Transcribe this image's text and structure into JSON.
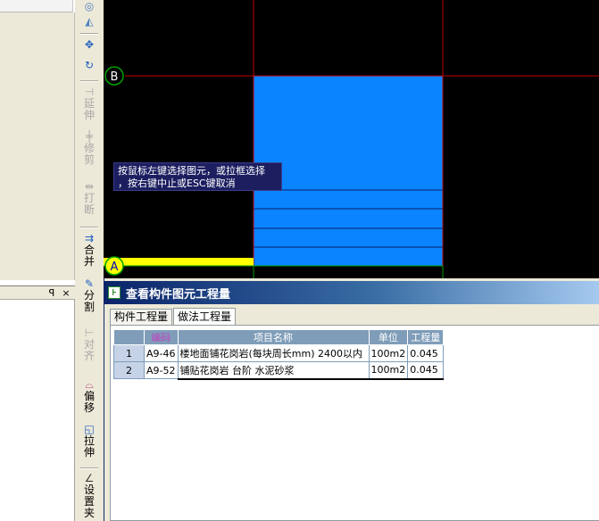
{
  "left_panel": {
    "lower_header": {
      "pin": "ꟼ",
      "close": "×"
    }
  },
  "toolbar": {
    "items": [
      {
        "name": "arc-tool",
        "icon": "◎",
        "label": "",
        "state": "enabled"
      },
      {
        "name": "mirror-tool",
        "icon": "◭",
        "label": "",
        "state": "enabled"
      },
      {
        "name": "move-tool",
        "icon": "✥",
        "label": "",
        "state": "enabled"
      },
      {
        "name": "rotate-tool",
        "icon": "↻",
        "label": "",
        "state": "enabled"
      },
      {
        "name": "extend-tool",
        "icon": "⊣",
        "label": "延伸",
        "state": "disabled"
      },
      {
        "name": "trim-tool",
        "icon": "╪",
        "label": "修剪",
        "state": "disabled"
      },
      {
        "name": "break-tool",
        "icon": "⇹",
        "label": "打断",
        "state": "disabled"
      },
      {
        "name": "merge-tool",
        "icon": "⇉",
        "label": "合并",
        "state": "enabled"
      },
      {
        "name": "split-tool",
        "icon": "✎",
        "label": "分割",
        "state": "enabled"
      },
      {
        "name": "align-tool",
        "icon": "⊢",
        "label": "对齐",
        "state": "disabled"
      },
      {
        "name": "offset-tool",
        "icon": "⌓",
        "label": "偏移",
        "state": "enabled"
      },
      {
        "name": "stretch-tool",
        "icon": "◱",
        "label": "拉伸",
        "state": "enabled"
      },
      {
        "name": "set-angle-tool",
        "icon": "∠",
        "label": "设置夹",
        "state": "enabled"
      }
    ]
  },
  "canvas": {
    "axis_labels": {
      "b": "B",
      "a": "A"
    },
    "hint": {
      "line1": "按鼠标左键选择图元，或拉框选择",
      "line2": "，按右键中止或ESC键取消"
    },
    "colors": {
      "background": "#000000",
      "fill": "#0a84ff",
      "grid_red": "#c00000",
      "axis_yellow": "#ffff00",
      "green": "#00a000"
    }
  },
  "qty_window": {
    "title": "查看构件图元工程量",
    "tabs": [
      {
        "label": "构件工程量",
        "active": false
      },
      {
        "label": "做法工程量",
        "active": true
      }
    ],
    "table": {
      "headers": {
        "row": "",
        "code": "编码",
        "name": "项目名称",
        "unit": "单位",
        "qty": "工程量"
      },
      "rows": [
        {
          "num": "1",
          "code": "A9-46",
          "name": "楼地面铺花岗岩(每块周长mm) 2400以内",
          "unit": "100m2",
          "qty": "0.045"
        },
        {
          "num": "2",
          "code": "A9-52",
          "name": "铺贴花岗岩 台阶 水泥砂浆",
          "unit": "100m2",
          "qty": "0.045"
        }
      ]
    }
  }
}
